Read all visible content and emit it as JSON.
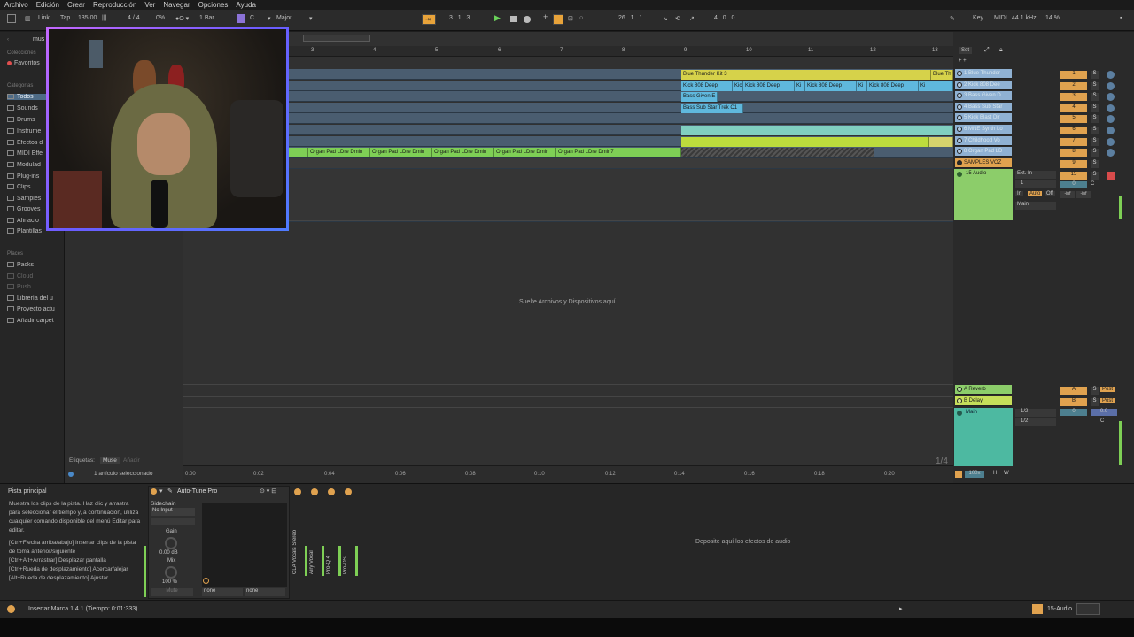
{
  "menu": [
    "Archivo",
    "Edición",
    "Crear",
    "Reproducción",
    "Ver",
    "Navegar",
    "Opciones",
    "Ayuda"
  ],
  "toolbar": {
    "link": "Link",
    "tap": "Tap",
    "tempo": "135.00",
    "time_sig": "4 / 4",
    "percent": "0%",
    "quantize": "1 Bar",
    "key": "C",
    "scale": "Major",
    "position": "3 .  1 .  3",
    "loop_start": "26 .  1 .  1",
    "loop_length": "4 .  0 .  0",
    "key_label": "Key",
    "midi_label": "MIDI",
    "sample_rate": "44.1 kHz",
    "cpu": "14 %"
  },
  "sidebar": {
    "collections_header": "Colecciones",
    "favorites": "Favoritos",
    "categories_header": "Categorías",
    "categories": [
      "Todos",
      "Sounds",
      "Drums",
      "Instrume",
      "Efectos d",
      "MIDI Effe",
      "Modulad",
      "Plug-ins",
      "Clips",
      "Samples",
      "Grooves",
      "Afinacio",
      "Plantillas"
    ],
    "places_header": "Places",
    "places": [
      "Packs",
      "Cloud",
      "Push",
      "Librería del u",
      "Proyecto actu",
      "Añadir carpet"
    ],
    "tags_label": "Etiquetas:",
    "tag": "Muse",
    "tag_add": "Añadir",
    "selection": "1 artículo seleccionado"
  },
  "browser": {
    "search_text": "mus"
  },
  "ruler": [
    "3",
    "4",
    "5",
    "6",
    "7",
    "8",
    "9",
    "10",
    "11",
    "12",
    "13"
  ],
  "clips": {
    "blue_thunder": "Blue Thunder Kit 3",
    "blue_thunder_short": "Blue Th",
    "kick": [
      "Kick 808 Deep",
      "Kic",
      "Kick 808 Deep",
      "Ki",
      "Kick 808 Deep",
      "Ki",
      "Kick 808 Deep",
      "Ki"
    ],
    "bass_given": "Bass Given E",
    "bass_sub": "Bass Sub Star Trek C1",
    "organ": [
      "Organ Pad LDre Dmin",
      "Organ Pad LDre Dmin",
      "Organ Pad LDre Dmin",
      "Organ Pad LDre Dmin",
      "Organ Pad LDre Dmin7"
    ]
  },
  "drop_files": "Suelte Archivos y Dispositivos aquí",
  "page_indicator": "1/4",
  "timeline": [
    "0:00",
    "0:02",
    "0:04",
    "0:06",
    "0:08",
    "0:10",
    "0:12",
    "0:14",
    "0:16",
    "0:18",
    "0:20"
  ],
  "mixer": {
    "set_label": "Set",
    "tracks": [
      {
        "name": "1 Blue Thunder",
        "num": "1",
        "color": "#8fb1d3"
      },
      {
        "name": "2 Kick 808 Dee",
        "num": "2",
        "color": "#8fb1d3"
      },
      {
        "name": "3 Bass Given D",
        "num": "3",
        "color": "#8fb1d3"
      },
      {
        "name": "4 Bass Sub Star",
        "num": "4",
        "color": "#8fb1d3"
      },
      {
        "name": "5 Kick Blast Dir",
        "num": "5",
        "color": "#8fb1d3"
      },
      {
        "name": "6 MNE Synth Lo",
        "num": "6",
        "color": "#8fb1d3"
      },
      {
        "name": "7 Childhood Vo",
        "num": "7",
        "color": "#8fb1d3"
      },
      {
        "name": "8 Organ Pad LD",
        "num": "8",
        "color": "#8fb1d3"
      },
      {
        "name": "SAMPLES VOZ",
        "num": "9",
        "color": "#e0a24f"
      }
    ],
    "audio_track": {
      "name": "15 Audio",
      "num": "15",
      "input": "Ext. In",
      "channel": "1",
      "monitor_in": "In",
      "monitor_auto": "Auto",
      "monitor_off": "Off",
      "output": "Main",
      "vol": "-inf",
      "pan": "-inf",
      "c": "C",
      "zero": "0"
    },
    "returns": [
      {
        "name": "A Reverb",
        "letter": "A"
      },
      {
        "name": "B Delay",
        "letter": "B"
      }
    ],
    "main_name": "Main",
    "main_out1": "1/2",
    "main_out2": "1/2",
    "main_vol": "0",
    "main_pan": "0.0",
    "main_c": "C",
    "solo": "S",
    "post": "Post",
    "zoom": "100x",
    "h": "H",
    "w": "W"
  },
  "info": {
    "title": "Pista principal",
    "text": "Muestra los clips de la pista. Haz clic y arrastra para seleccionar el tiempo y, a continuación, utiliza cualquier comando disponible del menú Editar para editar.",
    "shortcuts": [
      "[Ctrl+Flecha arriba/abajo] Insertar clips de la pista de toma anterior/siguiente",
      "[Ctrl+Alt+Arrastrar] Desplazar pantalla",
      "[Ctrl+Rueda de desplazamiento] Acercar/alejar",
      "[Alt+Rueda de desplazamiento] Ajustar"
    ]
  },
  "device": {
    "name": "Auto-Tune Pro",
    "sidechain_label": "Sidechain",
    "sidechain_value": "No Input",
    "gain_label": "Gain",
    "gain_value": "0.00 dB",
    "mix_label": "Mix",
    "mix_value": "100 %",
    "mute": "Mute",
    "none1": "none",
    "none2": "none",
    "plugins": [
      "CLA Vocals Stereo",
      "Airy Vocal",
      "Pro-Q 4",
      "Pro-DS"
    ]
  },
  "drop_effects": "Deposite aquí los efectos de audio",
  "status": {
    "message": "Insertar Marca 1.4.1 (Tiempo: 0:01:333)",
    "track": "15-Audio"
  },
  "colors": {
    "accent_orange": "#e8a33a",
    "clip_blue": "#5fb8dd",
    "clip_yellow": "#d6d24a",
    "clip_green": "#7ecf55",
    "track_blue": "#4a5d70",
    "return_green": "#8ccd6a",
    "main_teal": "#4db9a1"
  }
}
